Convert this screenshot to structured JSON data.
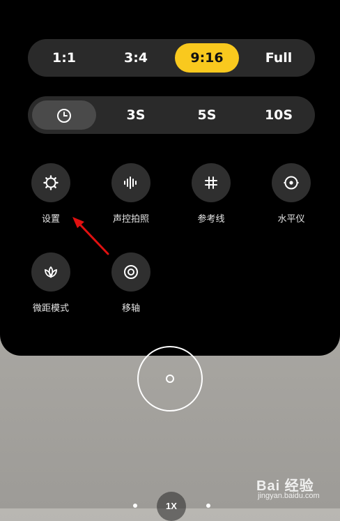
{
  "aspect_ratio": {
    "options": [
      "1:1",
      "3:4",
      "9:16",
      "Full"
    ],
    "selected": "9:16"
  },
  "timer": {
    "icon": "timer-icon",
    "options": [
      "3S",
      "5S",
      "10S"
    ]
  },
  "quick_options": [
    {
      "label": "设置",
      "icon": "settings-gear-icon"
    },
    {
      "label": "声控拍照",
      "icon": "sound-wave-icon"
    },
    {
      "label": "参考线",
      "icon": "grid-hash-icon"
    },
    {
      "label": "水平仪",
      "icon": "level-icon"
    },
    {
      "label": "微距模式",
      "icon": "macro-flower-icon"
    },
    {
      "label": "移轴",
      "icon": "tilt-shift-icon"
    }
  ],
  "zoom": "1X",
  "watermark": {
    "brand": "Bai 经验",
    "url": "jingyan.baidu.com"
  },
  "colors": {
    "accent": "#f9c91e",
    "panel": "#000000",
    "annotation_arrow": "#e01010"
  }
}
